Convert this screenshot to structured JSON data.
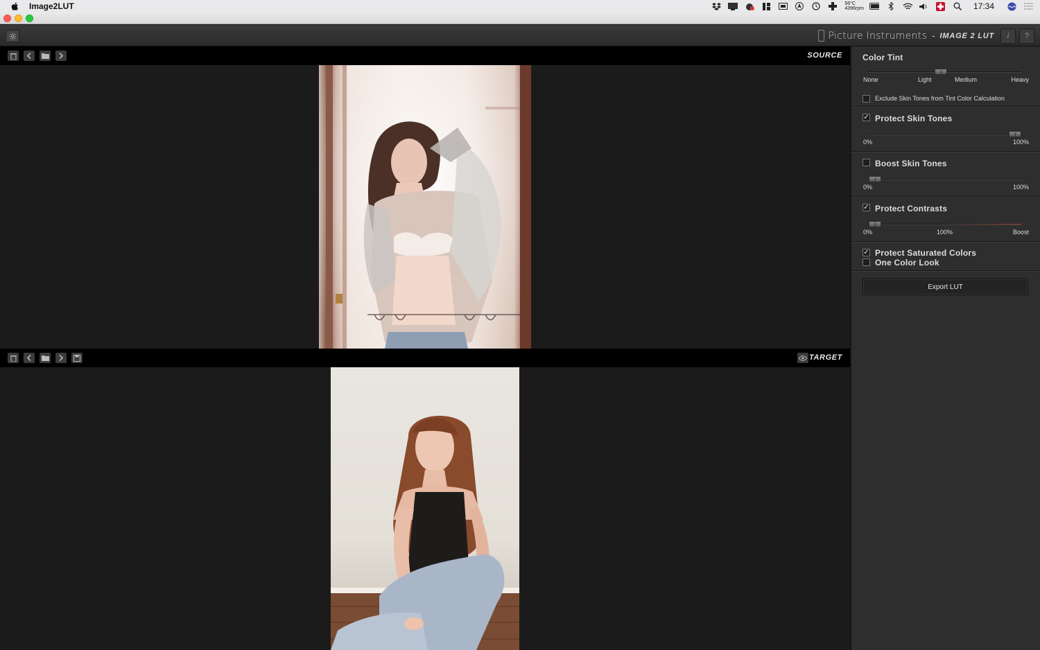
{
  "menubar": {
    "app_name": "Image2LUT",
    "temp": "56°C",
    "fan": "4396rpm",
    "clock": "17:34"
  },
  "header": {
    "brand": "Picture Instruments",
    "separator": "-",
    "product": "IMAGE 2 LUT",
    "info_label": "i",
    "help_label": "?"
  },
  "source_pane": {
    "label": "SOURCE"
  },
  "target_pane": {
    "label": "TARGET"
  },
  "panel": {
    "color_tint": {
      "title": "Color Tint",
      "ticks": [
        "None",
        "Light",
        "Medium",
        "Heavy"
      ],
      "value_fraction": 0.47,
      "exclude_label": "Exclude Skin Tones from Tint Color Calculation",
      "exclude_checked": false
    },
    "protect_skin": {
      "title": "Protect Skin Tones",
      "checked": true,
      "min_label": "0%",
      "max_label": "100%",
      "value_fraction": 1.0
    },
    "boost_skin": {
      "title": "Boost Skin Tones",
      "checked": false,
      "min_label": "0%",
      "max_label": "100%",
      "value_fraction": 0.0
    },
    "protect_contrasts": {
      "title": "Protect Contrasts",
      "checked": true,
      "min_label": "0%",
      "mid_label": "100%",
      "max_label": "Boost",
      "value_fraction": 0.0
    },
    "protect_saturated": {
      "title": "Protect Saturated Colors",
      "checked": true
    },
    "one_color": {
      "title": "One Color Look",
      "checked": false
    },
    "export_label": "Export LUT"
  },
  "checkmark": "✓"
}
